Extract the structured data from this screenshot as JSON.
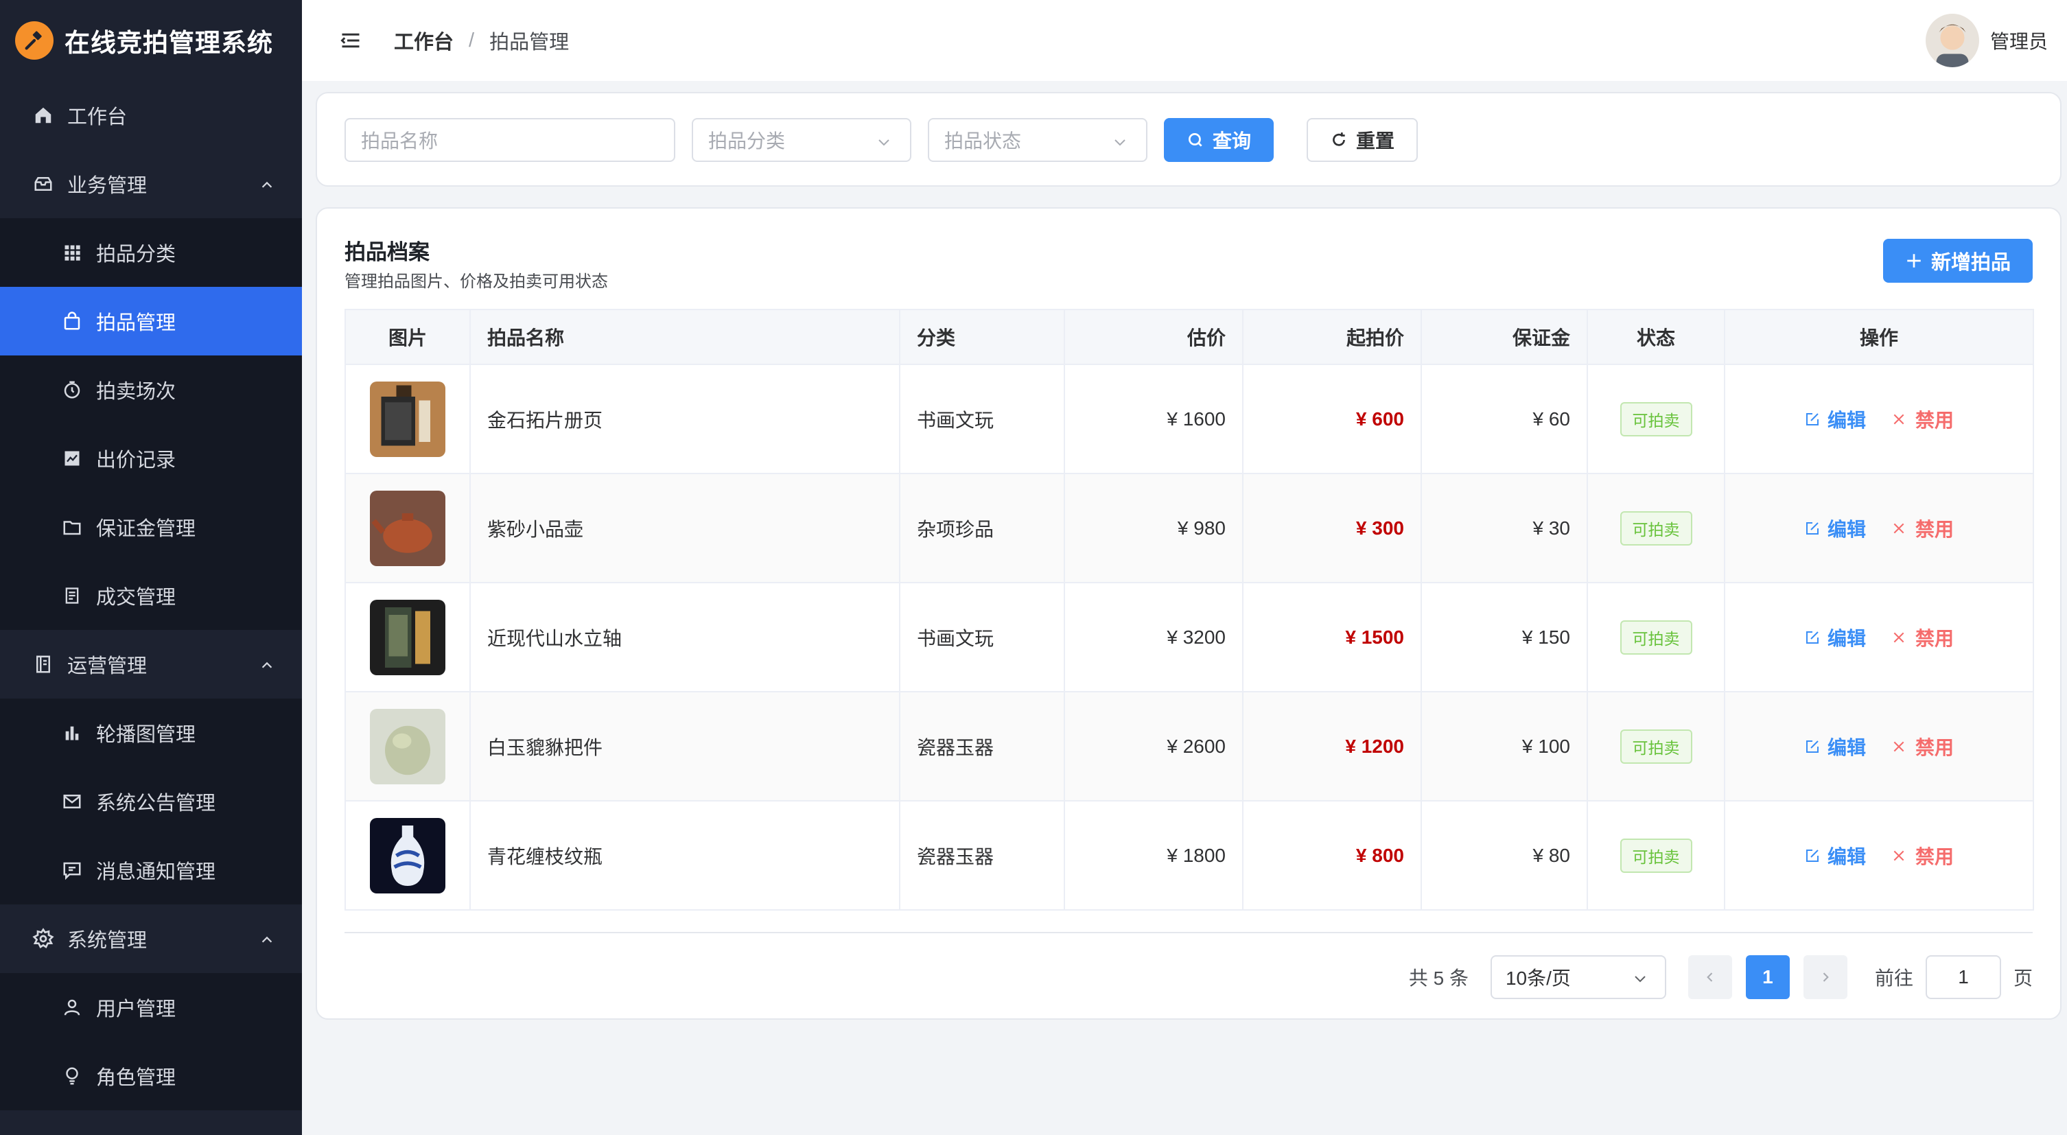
{
  "app": {
    "title": "在线竞拍管理系统"
  },
  "sidebar": {
    "items": [
      {
        "label": "工作台",
        "level": "top",
        "icon": "home-icon"
      },
      {
        "label": "业务管理",
        "level": "group",
        "icon": "box-icon"
      },
      {
        "label": "拍品分类",
        "level": "sub",
        "icon": "grid-icon"
      },
      {
        "label": "拍品管理",
        "level": "sub",
        "icon": "bag-icon",
        "active": true
      },
      {
        "label": "拍卖场次",
        "level": "sub",
        "icon": "timer-icon"
      },
      {
        "label": "出价记录",
        "level": "sub",
        "icon": "chart-icon"
      },
      {
        "label": "保证金管理",
        "level": "sub",
        "icon": "folder-icon"
      },
      {
        "label": "成交管理",
        "level": "sub",
        "icon": "document-icon"
      },
      {
        "label": "运营管理",
        "level": "group",
        "icon": "notebook-icon"
      },
      {
        "label": "轮播图管理",
        "level": "sub",
        "icon": "bar-chart-icon"
      },
      {
        "label": "系统公告管理",
        "level": "sub",
        "icon": "mail-icon"
      },
      {
        "label": "消息通知管理",
        "level": "sub",
        "icon": "message-icon"
      },
      {
        "label": "系统管理",
        "level": "group",
        "icon": "gear-icon"
      },
      {
        "label": "用户管理",
        "level": "sub",
        "icon": "user-icon"
      },
      {
        "label": "角色管理",
        "level": "sub",
        "icon": "bulb-icon"
      }
    ]
  },
  "header": {
    "breadcrumb": [
      "工作台",
      "拍品管理"
    ],
    "separator": "/",
    "user": "管理员"
  },
  "filter": {
    "name_placeholder": "拍品名称",
    "category_placeholder": "拍品分类",
    "status_placeholder": "拍品状态",
    "search_label": "查询",
    "reset_label": "重置"
  },
  "main": {
    "title": "拍品档案",
    "subtitle": "管理拍品图片、价格及拍卖可用状态",
    "add_label": "新增拍品",
    "columns": [
      "图片",
      "拍品名称",
      "分类",
      "估价",
      "起拍价",
      "保证金",
      "状态",
      "操作"
    ],
    "rows": [
      {
        "name": "金石拓片册页",
        "category": "书画文玩",
        "estimate": "¥ 1600",
        "start": "¥ 600",
        "deposit": "¥ 60",
        "status": "可拍卖",
        "edit": "编辑",
        "ban": "禁用"
      },
      {
        "name": "紫砂小品壶",
        "category": "杂项珍品",
        "estimate": "¥ 980",
        "start": "¥ 300",
        "deposit": "¥ 30",
        "status": "可拍卖",
        "edit": "编辑",
        "ban": "禁用"
      },
      {
        "name": "近现代山水立轴",
        "category": "书画文玩",
        "estimate": "¥ 3200",
        "start": "¥ 1500",
        "deposit": "¥ 150",
        "status": "可拍卖",
        "edit": "编辑",
        "ban": "禁用"
      },
      {
        "name": "白玉貔貅把件",
        "category": "瓷器玉器",
        "estimate": "¥ 2600",
        "start": "¥ 1200",
        "deposit": "¥ 100",
        "status": "可拍卖",
        "edit": "编辑",
        "ban": "禁用"
      },
      {
        "name": "青花缠枝纹瓶",
        "category": "瓷器玉器",
        "estimate": "¥ 1800",
        "start": "¥ 800",
        "deposit": "¥ 80",
        "status": "可拍卖",
        "edit": "编辑",
        "ban": "禁用"
      }
    ]
  },
  "pagination": {
    "total": "共 5 条",
    "page_size": "10条/页",
    "current": "1",
    "goto_label": "前往",
    "goto_value": "1",
    "page_suffix": "页"
  },
  "colors": {
    "primary": "#3a8ef6",
    "sidebar_bg": "#1d2230",
    "active_bg": "#2f6bed",
    "price": "#c00000",
    "danger": "#f56c6c",
    "success": "#67c23a"
  }
}
